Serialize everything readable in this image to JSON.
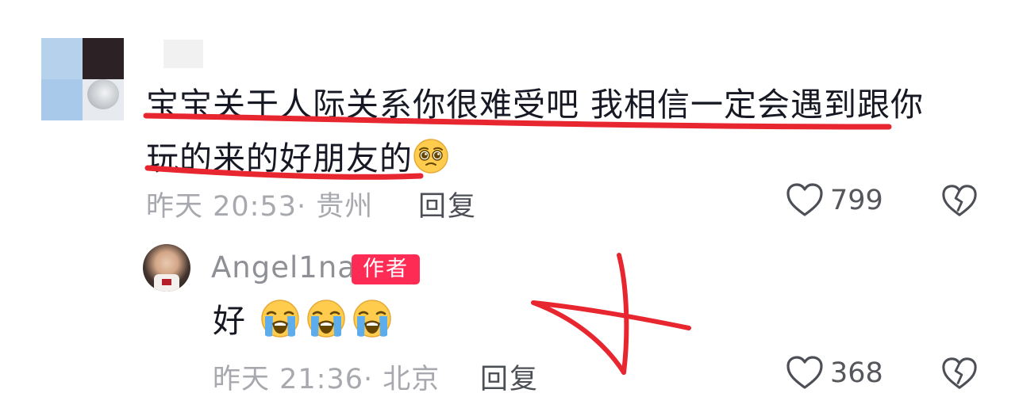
{
  "colors": {
    "text_primary": "#161823",
    "text_meta": "#a7a9ae",
    "author_badge": "#fe2c55",
    "annotation_red": "#e8262f"
  },
  "comments": [
    {
      "text_line1": "宝宝关于人际关系你很难受吧 我相信一定会遇到跟你",
      "text_line2": "玩的来的好朋友的",
      "emoji": "pleading-face",
      "timestamp": "昨天 20:53",
      "location": "· 贵州",
      "reply_label": "回复",
      "likes": "799"
    },
    {
      "username": "Angel1na",
      "badge": "作者",
      "text": "好",
      "emojis": [
        "loudly-crying-face",
        "loudly-crying-face",
        "loudly-crying-face"
      ],
      "timestamp": "昨天 21:36",
      "location": "· 北京",
      "reply_label": "回复",
      "likes": "368"
    }
  ],
  "icons": {
    "like": "heart-outline-icon",
    "dislike": "broken-heart-icon"
  }
}
